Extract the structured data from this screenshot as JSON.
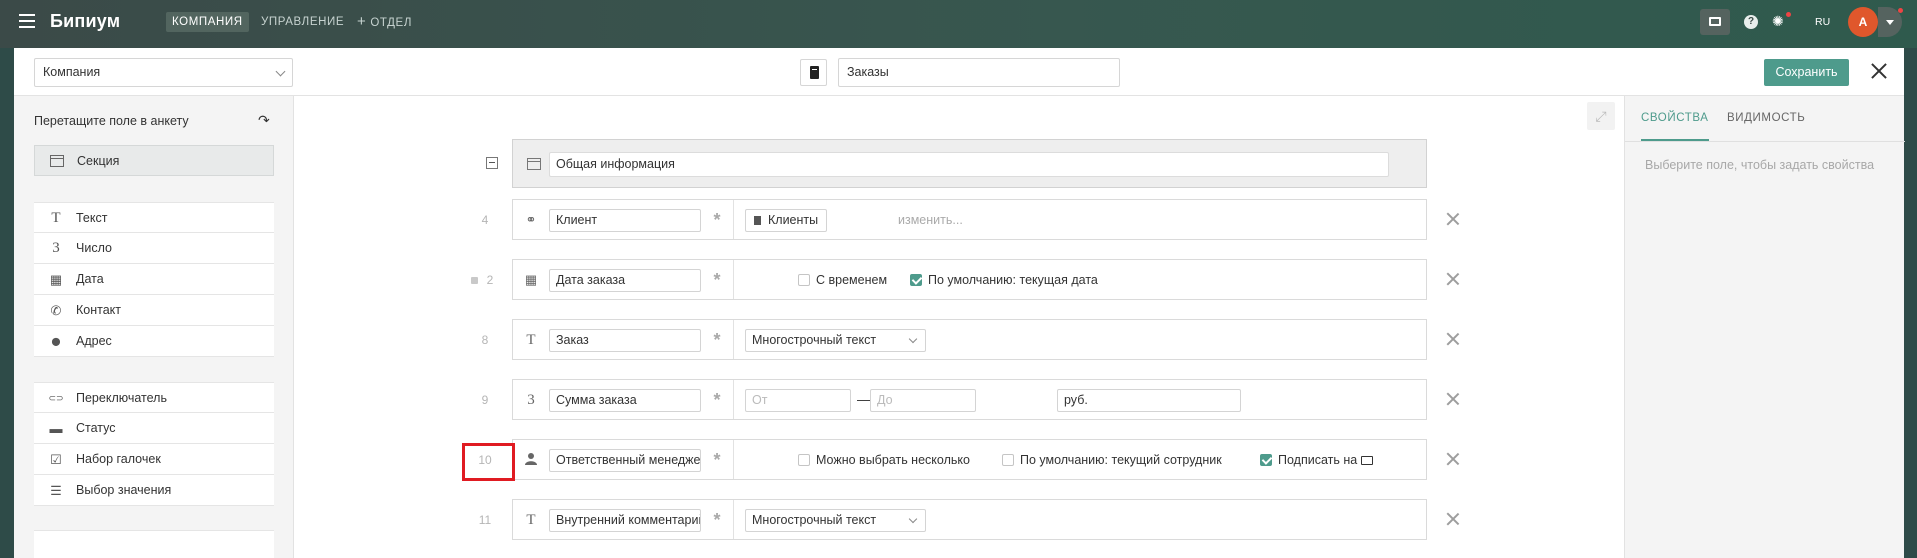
{
  "topbar": {
    "logo": "Бипиум",
    "nav": [
      "Компания",
      "Управление",
      "Отдел"
    ],
    "lang": "RU",
    "avatar_initial": "А",
    "help_glyph": "?"
  },
  "header": {
    "company_select": "Компания",
    "catalog_title": "Заказы",
    "save_label": "Сохранить"
  },
  "palette": {
    "title": "Перетащите поле в анкету",
    "section_item": "Секция",
    "group1": [
      {
        "label": "Текст",
        "icon": "text-icon",
        "glyph": "T"
      },
      {
        "label": "Число",
        "icon": "number-icon",
        "glyph": "3"
      },
      {
        "label": "Дата",
        "icon": "calendar-icon",
        "glyph": "▦"
      },
      {
        "label": "Контакт",
        "icon": "phone-icon",
        "glyph": "✆"
      },
      {
        "label": "Адрес",
        "icon": "map-pin-icon",
        "glyph": "⬤"
      }
    ],
    "group2": [
      {
        "label": "Переключатель",
        "icon": "toggle-icon",
        "glyph": "⊂⊃"
      },
      {
        "label": "Статус",
        "icon": "status-icon",
        "glyph": "▬"
      },
      {
        "label": "Набор галочек",
        "icon": "checkbox-set-icon",
        "glyph": "☑"
      },
      {
        "label": "Выбор значения",
        "icon": "list-icon",
        "glyph": "☰"
      }
    ]
  },
  "form": {
    "section_title": "Общая информация",
    "rows": [
      {
        "num": "4",
        "name": "Клиент",
        "icon": "link-icon",
        "glyph": "🔗",
        "chip": "Клиенты",
        "change": "изменить..."
      },
      {
        "num": "2",
        "name": "Дата заказа",
        "icon": "calendar-icon",
        "glyph": "▦",
        "opt1": "С временем",
        "opt2": "По умолчанию: текущая дата"
      },
      {
        "num": "8",
        "name": "Заказ",
        "icon": "text-icon",
        "glyph": "T",
        "select": "Многострочный текст"
      },
      {
        "num": "9",
        "name": "Сумма заказа",
        "icon": "number-icon",
        "glyph": "3",
        "from": "От",
        "to": "До",
        "unit": "руб."
      },
      {
        "num": "10",
        "name": "Ответственный менеджер",
        "icon": "user-icon",
        "glyph": "👤",
        "opt1": "Можно выбрать несколько",
        "opt2": "По умолчанию: текущий сотрудник",
        "opt3": "Подписать на"
      },
      {
        "num": "11",
        "name": "Внутренний комментарий",
        "icon": "text-icon",
        "glyph": "T",
        "select": "Многострочный текст"
      }
    ]
  },
  "props": {
    "tab_properties": "Свойства",
    "tab_visibility": "Видимость",
    "hint": "Выберите поле, чтобы задать свойства"
  },
  "colors": {
    "accent": "#4e9b8c",
    "highlight": "#e01b22",
    "topbar": "#37574f"
  }
}
